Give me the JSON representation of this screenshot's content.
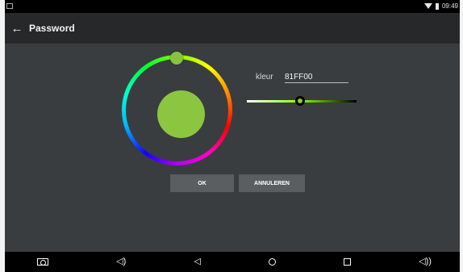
{
  "status_bar": {
    "time": "09:49"
  },
  "app_bar": {
    "title": "Password"
  },
  "color_picker": {
    "label": "kleur",
    "value": "81FF00",
    "slider_level": 0.5
  },
  "buttons": {
    "ok": "OK",
    "cancel": "ANNULEREN"
  },
  "navigation": {
    "items": [
      "camera-icon",
      "volume-down-icon",
      "back-icon",
      "home-icon",
      "recent-apps-icon",
      "volume-up-icon"
    ]
  },
  "colors": {
    "selected_hex": "#81FF00",
    "accent": "#8cc640"
  }
}
